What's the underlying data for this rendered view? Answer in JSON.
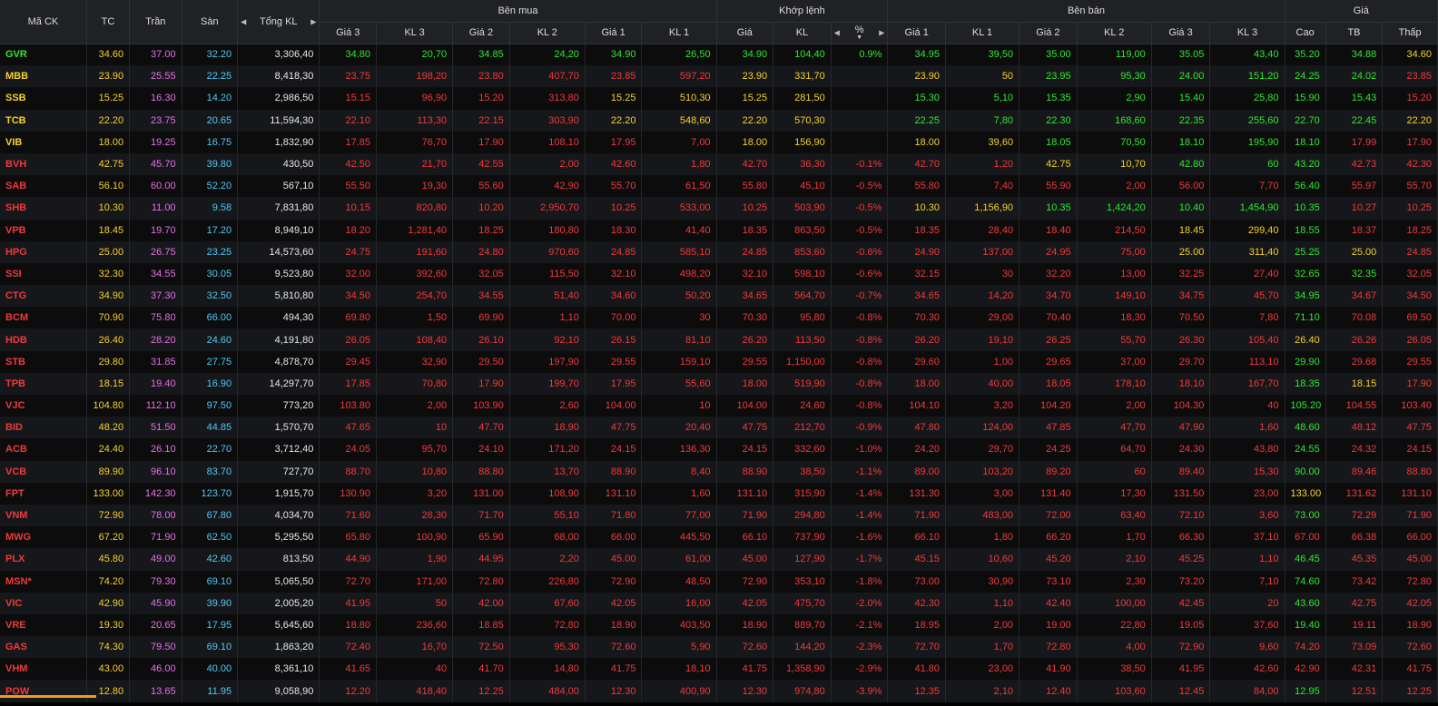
{
  "headers": {
    "symbol": "Mã CK",
    "ref": "TC",
    "ceil": "Trần",
    "floor": "Sàn",
    "total": "Tổng KL",
    "buy_group": "Bên mua",
    "match_group": "Khớp lệnh",
    "sell_group": "Bên bán",
    "price_group": "Giá",
    "buy_cols": [
      "Giá 3",
      "KL 3",
      "Giá 2",
      "KL 2",
      "Giá 1",
      "KL 1"
    ],
    "match_cols": [
      "Giá",
      "KL",
      "%"
    ],
    "sell_cols": [
      "Giá 1",
      "KL 1",
      "Giá 2",
      "KL 2",
      "Giá 3",
      "KL 3"
    ],
    "price_cols": [
      "Cao",
      "TB",
      "Thấp"
    ]
  },
  "colors": {
    "ref": "#f4d12a",
    "ceil": "#e56fe8",
    "floor": "#4ec9f2",
    "up": "#2ee82e",
    "down": "#f0393b"
  },
  "rows": [
    {
      "sym": "GVR",
      "tc": "34.60",
      "tr": "37.00",
      "sa": "32.20",
      "kl": "3,306,40",
      "b3": "34.80",
      "v3": "20,70",
      "b2": "34.85",
      "v2": "24,20",
      "b1": "34.90",
      "v1": "26,50",
      "mp": "34.90",
      "mv": "104,40",
      "pct": "0.9%",
      "s1": "34.95",
      "w1": "39,50",
      "s2": "35.00",
      "w2": "119,00",
      "s3": "35.05",
      "w3": "43,40",
      "hi": "35.20",
      "av": "34.88",
      "lo": "34.60"
    },
    {
      "sym": "MBB",
      "tc": "23.90",
      "tr": "25.55",
      "sa": "22.25",
      "kl": "8,418,30",
      "b3": "23.75",
      "v3": "198,20",
      "b2": "23.80",
      "v2": "407,70",
      "b1": "23.85",
      "v1": "597,20",
      "mp": "23.90",
      "mv": "331,70",
      "pct": "",
      "s1": "23.90",
      "w1": "50",
      "s2": "23.95",
      "w2": "95,30",
      "s3": "24.00",
      "w3": "151,20",
      "hi": "24.25",
      "av": "24.02",
      "lo": "23.85"
    },
    {
      "sym": "SSB",
      "tc": "15.25",
      "tr": "16.30",
      "sa": "14.20",
      "kl": "2,986,50",
      "b3": "15.15",
      "v3": "96,90",
      "b2": "15.20",
      "v2": "313,80",
      "b1": "15.25",
      "v1": "510,30",
      "mp": "15.25",
      "mv": "281,50",
      "pct": "",
      "s1": "15.30",
      "w1": "5,10",
      "s2": "15.35",
      "w2": "2,90",
      "s3": "15.40",
      "w3": "25,80",
      "hi": "15.90",
      "av": "15.43",
      "lo": "15.20"
    },
    {
      "sym": "TCB",
      "tc": "22.20",
      "tr": "23.75",
      "sa": "20.65",
      "kl": "11,594,30",
      "b3": "22.10",
      "v3": "113,30",
      "b2": "22.15",
      "v2": "303,90",
      "b1": "22.20",
      "v1": "548,60",
      "mp": "22.20",
      "mv": "570,30",
      "pct": "",
      "s1": "22.25",
      "w1": "7,80",
      "s2": "22.30",
      "w2": "168,60",
      "s3": "22.35",
      "w3": "255,60",
      "hi": "22.70",
      "av": "22.45",
      "lo": "22.20"
    },
    {
      "sym": "VIB",
      "tc": "18.00",
      "tr": "19.25",
      "sa": "16.75",
      "kl": "1,832,90",
      "b3": "17.85",
      "v3": "76,70",
      "b2": "17.90",
      "v2": "108,10",
      "b1": "17.95",
      "v1": "7,00",
      "mp": "18.00",
      "mv": "156,90",
      "pct": "",
      "s1": "18.00",
      "w1": "39,60",
      "s2": "18.05",
      "w2": "70,50",
      "s3": "18.10",
      "w3": "195,90",
      "hi": "18.10",
      "av": "17.99",
      "lo": "17.90"
    },
    {
      "sym": "BVH",
      "tc": "42.75",
      "tr": "45.70",
      "sa": "39.80",
      "kl": "430,50",
      "b3": "42.50",
      "v3": "21,70",
      "b2": "42.55",
      "v2": "2,00",
      "b1": "42.60",
      "v1": "1,80",
      "mp": "42.70",
      "mv": "36,30",
      "pct": "-0.1%",
      "s1": "42.70",
      "w1": "1,20",
      "s2": "42.75",
      "w2": "10,70",
      "s3": "42.80",
      "w3": "60",
      "hi": "43.20",
      "av": "42.73",
      "lo": "42.30"
    },
    {
      "sym": "SAB",
      "tc": "56.10",
      "tr": "60.00",
      "sa": "52.20",
      "kl": "567,10",
      "b3": "55.50",
      "v3": "19,30",
      "b2": "55.60",
      "v2": "42,90",
      "b1": "55.70",
      "v1": "61,50",
      "mp": "55.80",
      "mv": "45,10",
      "pct": "-0.5%",
      "s1": "55.80",
      "w1": "7,40",
      "s2": "55.90",
      "w2": "2,00",
      "s3": "56.00",
      "w3": "7,70",
      "hi": "56.40",
      "av": "55.97",
      "lo": "55.70"
    },
    {
      "sym": "SHB",
      "tc": "10.30",
      "tr": "11.00",
      "sa": "9.58",
      "kl": "7,831,80",
      "b3": "10.15",
      "v3": "820,80",
      "b2": "10.20",
      "v2": "2,950,70",
      "b1": "10.25",
      "v1": "533,00",
      "mp": "10.25",
      "mv": "503,90",
      "pct": "-0.5%",
      "s1": "10.30",
      "w1": "1,156,90",
      "s2": "10.35",
      "w2": "1,424,20",
      "s3": "10.40",
      "w3": "1,454,90",
      "hi": "10.35",
      "av": "10.27",
      "lo": "10.25"
    },
    {
      "sym": "VPB",
      "tc": "18.45",
      "tr": "19.70",
      "sa": "17.20",
      "kl": "8,949,10",
      "b3": "18.20",
      "v3": "1,281,40",
      "b2": "18.25",
      "v2": "180,80",
      "b1": "18.30",
      "v1": "41,40",
      "mp": "18.35",
      "mv": "863,50",
      "pct": "-0.5%",
      "s1": "18.35",
      "w1": "28,40",
      "s2": "18.40",
      "w2": "214,50",
      "s3": "18.45",
      "w3": "299,40",
      "hi": "18.55",
      "av": "18.37",
      "lo": "18.25"
    },
    {
      "sym": "HPG",
      "tc": "25.00",
      "tr": "26.75",
      "sa": "23.25",
      "kl": "14,573,60",
      "b3": "24.75",
      "v3": "191,60",
      "b2": "24.80",
      "v2": "970,60",
      "b1": "24.85",
      "v1": "585,10",
      "mp": "24.85",
      "mv": "853,60",
      "pct": "-0.6%",
      "s1": "24.90",
      "w1": "137,00",
      "s2": "24.95",
      "w2": "75,00",
      "s3": "25.00",
      "w3": "311,40",
      "hi": "25.25",
      "av": "25.00",
      "lo": "24.85"
    },
    {
      "sym": "SSI",
      "tc": "32.30",
      "tr": "34.55",
      "sa": "30.05",
      "kl": "9,523,80",
      "b3": "32.00",
      "v3": "392,60",
      "b2": "32.05",
      "v2": "115,50",
      "b1": "32.10",
      "v1": "498,20",
      "mp": "32.10",
      "mv": "598,10",
      "pct": "-0.6%",
      "s1": "32.15",
      "w1": "30",
      "s2": "32.20",
      "w2": "13,00",
      "s3": "32.25",
      "w3": "27,40",
      "hi": "32.65",
      "av": "32.35",
      "lo": "32.05"
    },
    {
      "sym": "CTG",
      "tc": "34.90",
      "tr": "37.30",
      "sa": "32.50",
      "kl": "5,810,80",
      "b3": "34.50",
      "v3": "254,70",
      "b2": "34.55",
      "v2": "51,40",
      "b1": "34.60",
      "v1": "50,20",
      "mp": "34.65",
      "mv": "564,70",
      "pct": "-0.7%",
      "s1": "34.65",
      "w1": "14,20",
      "s2": "34.70",
      "w2": "149,10",
      "s3": "34.75",
      "w3": "45,70",
      "hi": "34.95",
      "av": "34.67",
      "lo": "34.50"
    },
    {
      "sym": "BCM",
      "tc": "70.90",
      "tr": "75.80",
      "sa": "66.00",
      "kl": "494,30",
      "b3": "69.80",
      "v3": "1,50",
      "b2": "69.90",
      "v2": "1,10",
      "b1": "70.00",
      "v1": "30",
      "mp": "70.30",
      "mv": "95,80",
      "pct": "-0.8%",
      "s1": "70.30",
      "w1": "29,00",
      "s2": "70.40",
      "w2": "18,30",
      "s3": "70.50",
      "w3": "7,80",
      "hi": "71.10",
      "av": "70.08",
      "lo": "69.50"
    },
    {
      "sym": "HDB",
      "tc": "26.40",
      "tr": "28.20",
      "sa": "24.60",
      "kl": "4,191,80",
      "b3": "26.05",
      "v3": "108,40",
      "b2": "26.10",
      "v2": "92,10",
      "b1": "26.15",
      "v1": "81,10",
      "mp": "26.20",
      "mv": "113,50",
      "pct": "-0.8%",
      "s1": "26.20",
      "w1": "19,10",
      "s2": "26.25",
      "w2": "55,70",
      "s3": "26.30",
      "w3": "105,40",
      "hi": "26.40",
      "av": "26.26",
      "lo": "26.05"
    },
    {
      "sym": "STB",
      "tc": "29.80",
      "tr": "31.85",
      "sa": "27.75",
      "kl": "4,878,70",
      "b3": "29.45",
      "v3": "32,90",
      "b2": "29.50",
      "v2": "197,90",
      "b1": "29.55",
      "v1": "159,10",
      "mp": "29.55",
      "mv": "1,150,00",
      "pct": "-0.8%",
      "s1": "29.60",
      "w1": "1,00",
      "s2": "29.65",
      "w2": "37,00",
      "s3": "29.70",
      "w3": "113,10",
      "hi": "29.90",
      "av": "29.68",
      "lo": "29.55"
    },
    {
      "sym": "TPB",
      "tc": "18.15",
      "tr": "19.40",
      "sa": "16.90",
      "kl": "14,297,70",
      "b3": "17.85",
      "v3": "70,80",
      "b2": "17.90",
      "v2": "199,70",
      "b1": "17.95",
      "v1": "55,60",
      "mp": "18.00",
      "mv": "519,90",
      "pct": "-0.8%",
      "s1": "18.00",
      "w1": "40,00",
      "s2": "18.05",
      "w2": "178,10",
      "s3": "18.10",
      "w3": "167,70",
      "hi": "18.35",
      "av": "18.15",
      "lo": "17.90"
    },
    {
      "sym": "VJC",
      "tc": "104.80",
      "tr": "112.10",
      "sa": "97.50",
      "kl": "773,20",
      "b3": "103.80",
      "v3": "2,00",
      "b2": "103.90",
      "v2": "2,60",
      "b1": "104.00",
      "v1": "10",
      "mp": "104.00",
      "mv": "24,60",
      "pct": "-0.8%",
      "s1": "104.10",
      "w1": "3,20",
      "s2": "104.20",
      "w2": "2,00",
      "s3": "104.30",
      "w3": "40",
      "hi": "105.20",
      "av": "104.55",
      "lo": "103.40"
    },
    {
      "sym": "BID",
      "tc": "48.20",
      "tr": "51.50",
      "sa": "44.85",
      "kl": "1,570,70",
      "b3": "47.65",
      "v3": "10",
      "b2": "47.70",
      "v2": "18,90",
      "b1": "47.75",
      "v1": "20,40",
      "mp": "47.75",
      "mv": "212,70",
      "pct": "-0.9%",
      "s1": "47.80",
      "w1": "124,00",
      "s2": "47.85",
      "w2": "47,70",
      "s3": "47.90",
      "w3": "1,60",
      "hi": "48.60",
      "av": "48.12",
      "lo": "47.75"
    },
    {
      "sym": "ACB",
      "tc": "24.40",
      "tr": "26.10",
      "sa": "22.70",
      "kl": "3,712,40",
      "b3": "24.05",
      "v3": "95,70",
      "b2": "24.10",
      "v2": "171,20",
      "b1": "24.15",
      "v1": "136,30",
      "mp": "24.15",
      "mv": "332,60",
      "pct": "-1.0%",
      "s1": "24.20",
      "w1": "29,70",
      "s2": "24.25",
      "w2": "64,70",
      "s3": "24.30",
      "w3": "43,80",
      "hi": "24.55",
      "av": "24.32",
      "lo": "24.15"
    },
    {
      "sym": "VCB",
      "tc": "89.90",
      "tr": "96.10",
      "sa": "83.70",
      "kl": "727,70",
      "b3": "88.70",
      "v3": "10,80",
      "b2": "88.80",
      "v2": "13,70",
      "b1": "88.90",
      "v1": "8,40",
      "mp": "88.90",
      "mv": "38,50",
      "pct": "-1.1%",
      "s1": "89.00",
      "w1": "103,20",
      "s2": "89.20",
      "w2": "60",
      "s3": "89.40",
      "w3": "15,30",
      "hi": "90.00",
      "av": "89.46",
      "lo": "88.80"
    },
    {
      "sym": "FPT",
      "tc": "133.00",
      "tr": "142.30",
      "sa": "123.70",
      "kl": "1,915,70",
      "b3": "130.90",
      "v3": "3,20",
      "b2": "131.00",
      "v2": "108,90",
      "b1": "131.10",
      "v1": "1,60",
      "mp": "131.10",
      "mv": "315,90",
      "pct": "-1.4%",
      "s1": "131.30",
      "w1": "3,00",
      "s2": "131.40",
      "w2": "17,30",
      "s3": "131.50",
      "w3": "23,00",
      "hi": "133.00",
      "av": "131.62",
      "lo": "131.10"
    },
    {
      "sym": "VNM",
      "tc": "72.90",
      "tr": "78.00",
      "sa": "67.80",
      "kl": "4,034,70",
      "b3": "71.60",
      "v3": "26,30",
      "b2": "71.70",
      "v2": "55,10",
      "b1": "71.80",
      "v1": "77,00",
      "mp": "71.90",
      "mv": "294,80",
      "pct": "-1.4%",
      "s1": "71.90",
      "w1": "483,00",
      "s2": "72.00",
      "w2": "63,40",
      "s3": "72.10",
      "w3": "3,60",
      "hi": "73.00",
      "av": "72.29",
      "lo": "71.90"
    },
    {
      "sym": "MWG",
      "tc": "67.20",
      "tr": "71.90",
      "sa": "62.50",
      "kl": "5,295,50",
      "b3": "65.80",
      "v3": "100,90",
      "b2": "65.90",
      "v2": "68,00",
      "b1": "66.00",
      "v1": "445,50",
      "mp": "66.10",
      "mv": "737,90",
      "pct": "-1.6%",
      "s1": "66.10",
      "w1": "1,80",
      "s2": "66.20",
      "w2": "1,70",
      "s3": "66.30",
      "w3": "37,10",
      "hi": "67.00",
      "av": "66.38",
      "lo": "66.00"
    },
    {
      "sym": "PLX",
      "tc": "45.80",
      "tr": "49.00",
      "sa": "42.60",
      "kl": "813,50",
      "b3": "44.90",
      "v3": "1,90",
      "b2": "44.95",
      "v2": "2,20",
      "b1": "45.00",
      "v1": "61,00",
      "mp": "45.00",
      "mv": "127,90",
      "pct": "-1.7%",
      "s1": "45.15",
      "w1": "10,60",
      "s2": "45.20",
      "w2": "2,10",
      "s3": "45.25",
      "w3": "1,10",
      "hi": "46.45",
      "av": "45.35",
      "lo": "45.00"
    },
    {
      "sym": "MSN*",
      "tc": "74.20",
      "tr": "79.30",
      "sa": "69.10",
      "kl": "5,065,50",
      "b3": "72.70",
      "v3": "171,00",
      "b2": "72.80",
      "v2": "226,80",
      "b1": "72.90",
      "v1": "48,50",
      "mp": "72.90",
      "mv": "353,10",
      "pct": "-1.8%",
      "s1": "73.00",
      "w1": "30,90",
      "s2": "73.10",
      "w2": "2,30",
      "s3": "73.20",
      "w3": "7,10",
      "hi": "74.60",
      "av": "73.42",
      "lo": "72.80"
    },
    {
      "sym": "VIC",
      "tc": "42.90",
      "tr": "45.90",
      "sa": "39.90",
      "kl": "2,005,20",
      "b3": "41.95",
      "v3": "50",
      "b2": "42.00",
      "v2": "67,60",
      "b1": "42.05",
      "v1": "16,00",
      "mp": "42.05",
      "mv": "475,70",
      "pct": "-2.0%",
      "s1": "42.30",
      "w1": "1,10",
      "s2": "42.40",
      "w2": "100,00",
      "s3": "42.45",
      "w3": "20",
      "hi": "43.60",
      "av": "42.75",
      "lo": "42.05"
    },
    {
      "sym": "VRE",
      "tc": "19.30",
      "tr": "20.65",
      "sa": "17.95",
      "kl": "5,645,60",
      "b3": "18.80",
      "v3": "236,60",
      "b2": "18.85",
      "v2": "72,80",
      "b1": "18.90",
      "v1": "403,50",
      "mp": "18.90",
      "mv": "889,70",
      "pct": "-2.1%",
      "s1": "18.95",
      "w1": "2,00",
      "s2": "19.00",
      "w2": "22,80",
      "s3": "19.05",
      "w3": "37,60",
      "hi": "19.40",
      "av": "19.11",
      "lo": "18.90"
    },
    {
      "sym": "GAS",
      "tc": "74.30",
      "tr": "79.50",
      "sa": "69.10",
      "kl": "1,863,20",
      "b3": "72.40",
      "v3": "16,70",
      "b2": "72.50",
      "v2": "95,30",
      "b1": "72.60",
      "v1": "5,90",
      "mp": "72.60",
      "mv": "144,20",
      "pct": "-2.3%",
      "s1": "72.70",
      "w1": "1,70",
      "s2": "72.80",
      "w2": "4,00",
      "s3": "72.90",
      "w3": "9,60",
      "hi": "74.20",
      "av": "73.09",
      "lo": "72.60"
    },
    {
      "sym": "VHM",
      "tc": "43.00",
      "tr": "46.00",
      "sa": "40.00",
      "kl": "8,361,10",
      "b3": "41.65",
      "v3": "40",
      "b2": "41.70",
      "v2": "14,80",
      "b1": "41.75",
      "v1": "18,10",
      "mp": "41.75",
      "mv": "1,358,90",
      "pct": "-2.9%",
      "s1": "41.80",
      "w1": "23,00",
      "s2": "41.90",
      "w2": "38,50",
      "s3": "41.95",
      "w3": "42,60",
      "hi": "42.90",
      "av": "42.31",
      "lo": "41.75"
    },
    {
      "sym": "POW",
      "tc": "12.80",
      "tr": "13.65",
      "sa": "11.95",
      "kl": "9,058,90",
      "b3": "12.20",
      "v3": "418,40",
      "b2": "12.25",
      "v2": "484,00",
      "b1": "12.30",
      "v1": "400,90",
      "mp": "12.30",
      "mv": "974,80",
      "pct": "-3.9%",
      "s1": "12.35",
      "w1": "2,10",
      "s2": "12.40",
      "w2": "103,60",
      "s3": "12.45",
      "w3": "84,00",
      "hi": "12.95",
      "av": "12.51",
      "lo": "12.25"
    }
  ]
}
